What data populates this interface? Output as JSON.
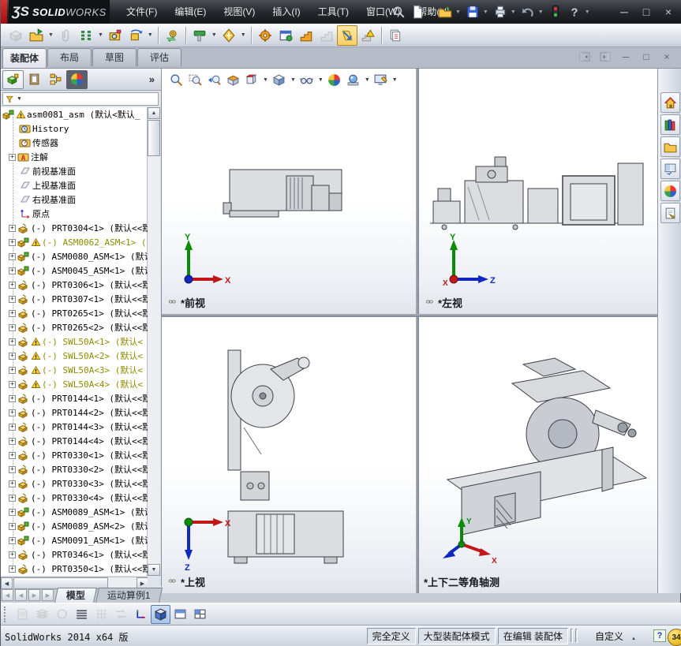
{
  "titlebar": {
    "logo_mark": "ƷS",
    "brand_solid": "SOLID",
    "brand_works": "WORKS",
    "menus": [
      "文件(F)",
      "编辑(E)",
      "视图(V)",
      "插入(I)",
      "工具(T)",
      "窗口(W)",
      "帮助(H)"
    ],
    "quick_icons": [
      "search",
      "new-document",
      "open-document",
      "save",
      "print",
      "undo",
      "rebuild-traffic-light",
      "help"
    ],
    "window_buttons": [
      {
        "name": "minimize",
        "glyph": "─"
      },
      {
        "name": "restore",
        "glyph": "□"
      },
      {
        "name": "close",
        "glyph": "×"
      }
    ]
  },
  "assembly_toolbar": [
    {
      "name": "edit-component",
      "glyph": "cubeGray",
      "disabled": true
    },
    {
      "name": "insert-component",
      "glyph": "folderOpen",
      "caret": true
    },
    {
      "name": "attach-component",
      "glyph": "paperclip",
      "disabled": true
    },
    {
      "name": "component-pattern",
      "glyph": "patternGreen",
      "caret": true
    },
    {
      "name": "assembly-features",
      "glyph": "cameraBox"
    },
    {
      "name": "rotate-component",
      "glyph": "rotateYellow",
      "caret": true
    },
    {
      "sep": true
    },
    {
      "name": "move-component",
      "glyph": "gearSwap"
    },
    {
      "sep": true
    },
    {
      "name": "smart-fasteners",
      "glyph": "hammerGreen",
      "caret": true
    },
    {
      "name": "reference-geometry",
      "glyph": "starYellow",
      "caret": true
    },
    {
      "sep": true
    },
    {
      "name": "simulation",
      "glyph": "gearOrange"
    },
    {
      "name": "component-preview-window",
      "glyph": "windowGreen"
    },
    {
      "name": "exploded-view",
      "glyph": "stairsOrange"
    },
    {
      "name": "explode-line-sketch",
      "glyph": "stairsGray",
      "disabled": true
    },
    {
      "name": "large-assembly-mode",
      "glyph": "arrowSlant",
      "pressed": true
    },
    {
      "name": "interference-detection",
      "glyph": "warnStairs"
    },
    {
      "sep": true
    },
    {
      "name": "bill-of-materials",
      "glyph": "papers"
    }
  ],
  "command_tabs": [
    {
      "label": "装配体",
      "active": true
    },
    {
      "label": "布局",
      "active": false
    },
    {
      "label": "草图",
      "active": false
    },
    {
      "label": "评估",
      "active": false
    }
  ],
  "mdi_controls": [
    {
      "name": "pane-left",
      "glyph": "paneL"
    },
    {
      "name": "pane-right",
      "glyph": "paneR"
    },
    {
      "name": "doc-minimize",
      "text": "─"
    },
    {
      "name": "doc-restore",
      "text": "□"
    },
    {
      "name": "doc-close",
      "text": "×"
    }
  ],
  "panel": {
    "tabs": [
      {
        "name": "featuremanager-tab",
        "glyph": "asmGreen",
        "active": true
      },
      {
        "name": "propertymanager-tab",
        "glyph": "clipboard"
      },
      {
        "name": "configurationmanager-tab",
        "glyph": "config"
      },
      {
        "name": "displaymanager-tab",
        "glyph": "ball",
        "dark": true
      }
    ],
    "more": "»",
    "tree": [
      {
        "glyph": "assembly",
        "warn": true,
        "root": true,
        "label": "asm0081_asm",
        "suffix": "(默认<默认_"
      },
      {
        "glyph": "historyI",
        "label": "History"
      },
      {
        "glyph": "sensorsI",
        "label": "传感器"
      },
      {
        "glyph": "annotI",
        "label": "注解",
        "exp": true
      },
      {
        "glyph": "plane",
        "label": "前视基准面"
      },
      {
        "glyph": "plane",
        "label": "上视基准面"
      },
      {
        "glyph": "plane",
        "label": "右视基准面"
      },
      {
        "glyph": "origin",
        "label": "原点"
      },
      {
        "glyph": "part",
        "exp": true,
        "pre": "(-)",
        "label": "PRT0304<1>",
        "suffix": "(默认<<默"
      },
      {
        "glyph": "assembly",
        "warn": true,
        "wt": true,
        "exp": true,
        "pre": "(-)",
        "label": "ASM0062_ASM<1>",
        "suffix": "("
      },
      {
        "glyph": "assembly",
        "exp": true,
        "pre": "(-)",
        "label": "ASM0080_ASM<1>",
        "suffix": "(默认"
      },
      {
        "glyph": "assembly",
        "exp": true,
        "pre": "(-)",
        "label": "ASM0045_ASM<1>",
        "suffix": "(默认"
      },
      {
        "glyph": "part",
        "exp": true,
        "pre": "(-)",
        "label": "PRT0306<1>",
        "suffix": "(默认<<默"
      },
      {
        "glyph": "part",
        "exp": true,
        "pre": "(-)",
        "label": "PRT0307<1>",
        "suffix": "(默认<<默"
      },
      {
        "glyph": "part",
        "exp": true,
        "pre": "(-)",
        "label": "PRT0265<1>",
        "suffix": "(默认<<默"
      },
      {
        "glyph": "part",
        "exp": true,
        "pre": "(-)",
        "label": "PRT0265<2>",
        "suffix": "(默认<<默"
      },
      {
        "glyph": "part",
        "warn": true,
        "wt": true,
        "exp": true,
        "pre": "(-)",
        "label": "SWL50A<1>",
        "suffix": "(默认<"
      },
      {
        "glyph": "part",
        "warn": true,
        "wt": true,
        "exp": true,
        "pre": "(-)",
        "label": "SWL50A<2>",
        "suffix": "(默认<"
      },
      {
        "glyph": "part",
        "warn": true,
        "wt": true,
        "exp": true,
        "pre": "(-)",
        "label": "SWL50A<3>",
        "suffix": "(默认<"
      },
      {
        "glyph": "part",
        "warn": true,
        "wt": true,
        "exp": true,
        "pre": "(-)",
        "label": "SWL50A<4>",
        "suffix": "(默认<"
      },
      {
        "glyph": "part",
        "exp": true,
        "pre": "(-)",
        "label": "PRT0144<1>",
        "suffix": "(默认<<默"
      },
      {
        "glyph": "part",
        "exp": true,
        "pre": "(-)",
        "label": "PRT0144<2>",
        "suffix": "(默认<<默"
      },
      {
        "glyph": "part",
        "exp": true,
        "pre": "(-)",
        "label": "PRT0144<3>",
        "suffix": "(默认<<默"
      },
      {
        "glyph": "part",
        "exp": true,
        "pre": "(-)",
        "label": "PRT0144<4>",
        "suffix": "(默认<<默"
      },
      {
        "glyph": "part",
        "exp": true,
        "pre": "(-)",
        "label": "PRT0330<1>",
        "suffix": "(默认<<默"
      },
      {
        "glyph": "part",
        "exp": true,
        "pre": "(-)",
        "label": "PRT0330<2>",
        "suffix": "(默认<<默"
      },
      {
        "glyph": "part",
        "exp": true,
        "pre": "(-)",
        "label": "PRT0330<3>",
        "suffix": "(默认<<默"
      },
      {
        "glyph": "part",
        "exp": true,
        "pre": "(-)",
        "label": "PRT0330<4>",
        "suffix": "(默认<<默"
      },
      {
        "glyph": "assembly",
        "exp": true,
        "pre": "(-)",
        "label": "ASM0089_ASM<1>",
        "suffix": "(默认"
      },
      {
        "glyph": "assembly",
        "exp": true,
        "pre": "(-)",
        "label": "ASM0089_ASM<2>",
        "suffix": "(默认"
      },
      {
        "glyph": "assembly",
        "exp": true,
        "pre": "(-)",
        "label": "ASM0091_ASM<1>",
        "suffix": "(默认"
      },
      {
        "glyph": "part",
        "exp": true,
        "pre": "(-)",
        "label": "PRT0346<1>",
        "suffix": "(默认<<默"
      },
      {
        "glyph": "part",
        "exp": true,
        "pre": "(-)",
        "label": "PRT0350<1>",
        "suffix": "(默认<<默"
      }
    ]
  },
  "headsup_toolbar": [
    {
      "name": "zoom-to-fit",
      "glyph": "zoomFit"
    },
    {
      "name": "zoom-to-area",
      "glyph": "zoomArea"
    },
    {
      "name": "previous-view",
      "glyph": "zoomPrev"
    },
    {
      "name": "section-view",
      "glyph": "section"
    },
    {
      "name": "view-orientation",
      "glyph": "viewOrient",
      "caret": true
    },
    {
      "name": "display-style",
      "glyph": "dispStyle",
      "caret": true
    },
    {
      "name": "hide-show-items",
      "glyph": "glasses",
      "caret": true
    },
    {
      "name": "edit-appearance",
      "glyph": "ball"
    },
    {
      "name": "apply-scene",
      "glyph": "scene",
      "caret": true
    },
    {
      "name": "view-settings",
      "glyph": "viewSet",
      "caret": true
    }
  ],
  "taskpane_icons": [
    {
      "name": "solidworks-resources",
      "glyph": "home"
    },
    {
      "name": "design-library",
      "glyph": "books"
    },
    {
      "name": "file-explorer",
      "glyph": "folder"
    },
    {
      "name": "view-palette",
      "glyph": "palette"
    },
    {
      "name": "appearances-scenes",
      "glyph": "ball"
    },
    {
      "name": "custom-properties",
      "glyph": "form"
    }
  ],
  "viewports": [
    {
      "label": "*前视",
      "linked": true
    },
    {
      "label": "*左视",
      "linked": true
    },
    {
      "label": "*上视",
      "linked": true
    },
    {
      "label": "*上下二等角轴测",
      "linked": false
    }
  ],
  "axes": {
    "x": "X",
    "y": "Y",
    "z": "Z"
  },
  "bottom": {
    "nav": [
      "◀",
      "◀",
      "▶",
      "▶"
    ],
    "tabs": [
      {
        "label": "模型",
        "active": true
      },
      {
        "label": "运动算例1",
        "active": false
      }
    ],
    "toolbar": [
      {
        "name": "sketch-pages",
        "glyph": "pagesG",
        "disabled": true
      },
      {
        "name": "layers",
        "glyph": "layersG",
        "disabled": true
      },
      {
        "name": "rotate-view",
        "glyph": "rotateG",
        "disabled": true
      },
      {
        "name": "tangent-edges",
        "glyph": "linesD"
      },
      {
        "name": "draft-grid",
        "glyph": "gridG",
        "disabled": true
      },
      {
        "name": "swap-views",
        "glyph": "swapG",
        "disabled": true
      },
      {
        "name": "axes-display",
        "glyph": "axisI"
      },
      {
        "name": "shaded-with-edges",
        "glyph": "cubeShaded",
        "pressed": true
      },
      {
        "name": "single-viewport",
        "glyph": "winSplit"
      },
      {
        "name": "four-viewports",
        "glyph": "winGrid"
      }
    ]
  },
  "statusbar": {
    "left": "SolidWorks 2014 x64 版",
    "segments": [
      "完全定义",
      "大型装配体模式",
      "在编辑 装配体"
    ],
    "custom": "自定义",
    "help": "?",
    "badge": "34"
  }
}
